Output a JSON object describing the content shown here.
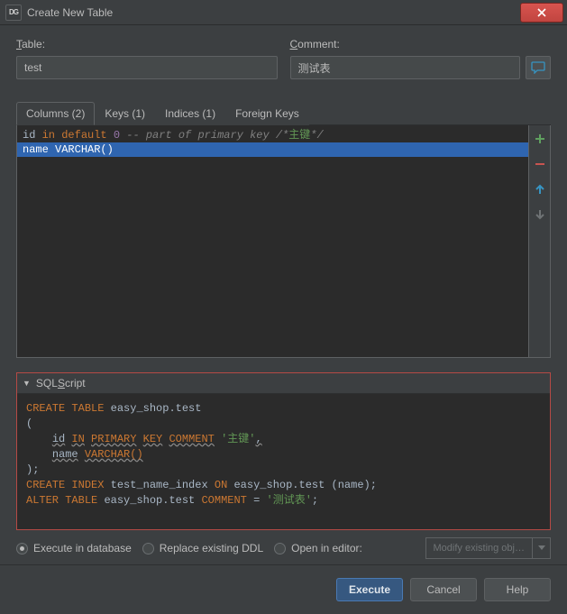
{
  "titlebar": {
    "icon_text": "DG",
    "title": "Create New Table"
  },
  "labels": {
    "table": "able:",
    "table_prefix": "T",
    "comment_prefix": "C",
    "comment": "omment:"
  },
  "form": {
    "table_value": "test",
    "comment_value": "测试表"
  },
  "tabs": {
    "columns": "Columns (2)",
    "keys": "Keys (1)",
    "indices": "Indices (1)",
    "foreign": "Foreign Keys"
  },
  "cols": {
    "r0": {
      "ident": "id",
      "kw1": "in",
      "kw2": "default",
      "num": "0",
      "cmt1": "-- part of primary key /*",
      "cmt2": "主键",
      "cmt3": "*/"
    },
    "r1": {
      "ident": "name",
      "type": "VARCHAR()"
    }
  },
  "script": {
    "header_prefix": "SQL ",
    "header_ul": "S",
    "header_rest": "cript",
    "l1a": "CREATE",
    "l1b": "TABLE",
    "l1c": "easy_shop.test",
    "l2": "(",
    "l3a": "id",
    "l3b": "IN",
    "l3c": "PRIMARY",
    "l3d": "KEY",
    "l3e": "COMMENT",
    "l3f": "'主键'",
    "l3g": ",",
    "l4a": "name",
    "l4b": "VARCHAR()",
    "l5": ");",
    "l6a": "CREATE",
    "l6b": "INDEX",
    "l6c": "test_name_index",
    "l6d": "ON",
    "l6e": "easy_shop.test",
    "l6f": "(name);",
    "l7a": "ALTER",
    "l7b": "TABLE",
    "l7c": "easy_shop.test",
    "l7d": "COMMENT",
    "l7e": "=",
    "l7f": "'测试表'",
    "l7g": ";"
  },
  "options": {
    "exec_db": "Execute in database",
    "replace_ddl": "Replace existing DDL",
    "open_editor": "Open in editor:",
    "dropdown": "Modify existing obj…"
  },
  "actions": {
    "execute": "Execute",
    "cancel": "Cancel",
    "help": "Help"
  }
}
